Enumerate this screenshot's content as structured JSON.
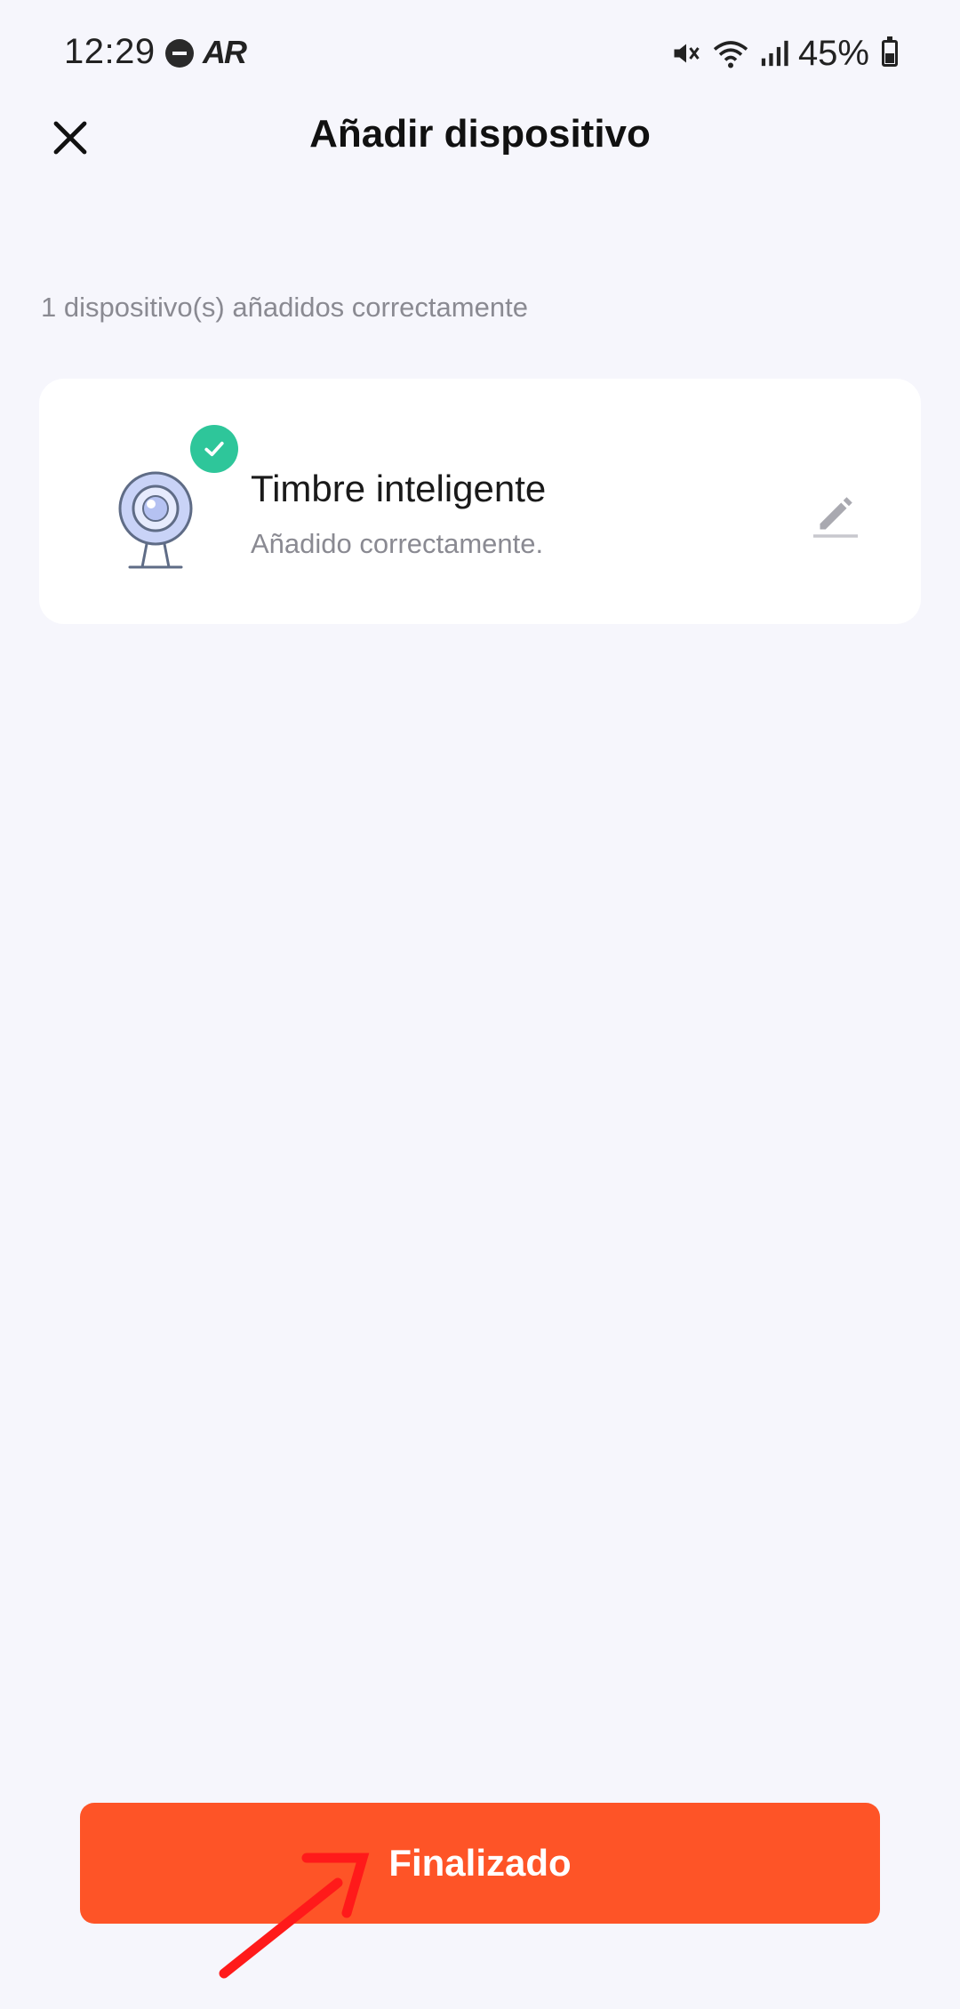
{
  "status_bar": {
    "time": "12:29",
    "ar_label": "AR",
    "battery": "45%"
  },
  "header": {
    "title": "Añadir dispositivo"
  },
  "summary": {
    "text": "1 dispositivo(s) añadidos correctamente"
  },
  "device": {
    "name": "Timbre inteligente",
    "status": "Añadido correctamente."
  },
  "footer": {
    "finish_label": "Finalizado"
  },
  "colors": {
    "background": "#f6f6fc",
    "accent": "#fe5427",
    "success": "#2ec69a",
    "annotation": "#ff1a1a"
  },
  "icons": {
    "close": "close-icon",
    "check": "check-icon",
    "device": "camera-icon",
    "edit": "pencil-icon"
  }
}
